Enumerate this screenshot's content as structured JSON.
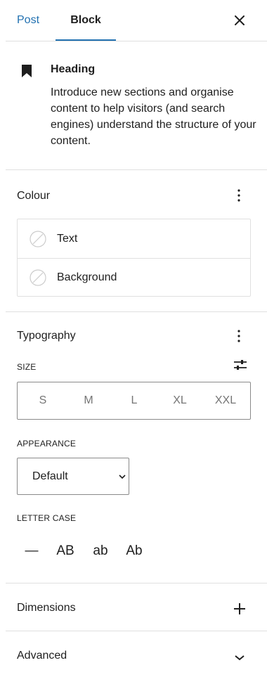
{
  "tabs": {
    "post_label": "Post",
    "block_label": "Block",
    "close_icon": "close-icon"
  },
  "block_card": {
    "icon": "bookmark-icon",
    "title": "Heading",
    "description": "Introduce new sections and organise content to help visitors (and search engines) understand the structure of your content."
  },
  "colour_panel": {
    "title": "Colour",
    "items": [
      {
        "label": "Text",
        "icon": "empty-swatch-icon"
      },
      {
        "label": "Background",
        "icon": "empty-swatch-icon"
      }
    ]
  },
  "typography_panel": {
    "title": "Typography",
    "size_label": "SIZE",
    "size_options": [
      "S",
      "M",
      "L",
      "XL",
      "XXL"
    ],
    "appearance_label": "APPEARANCE",
    "appearance_value": "Default",
    "letter_case_label": "LETTER CASE",
    "letter_case_options": [
      "—",
      "AB",
      "ab",
      "Ab"
    ]
  },
  "dimensions_panel": {
    "title": "Dimensions"
  },
  "advanced_panel": {
    "title": "Advanced"
  },
  "colors": {
    "accent": "#2271b1",
    "border": "#e0e0e0",
    "text": "#1e1e1e",
    "muted": "#757575"
  }
}
